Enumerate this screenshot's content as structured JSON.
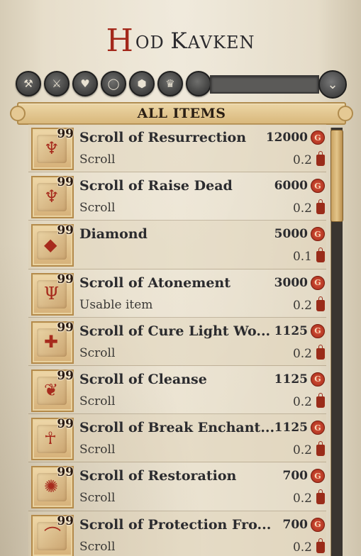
{
  "header": {
    "title_first": "H",
    "title_rest": "OD ",
    "title_second": "K",
    "title_second_rest": "AVKEN"
  },
  "filters": [
    {
      "icon": "crossed-tools-icon",
      "glyph": "⚒"
    },
    {
      "icon": "crossed-swords-icon",
      "glyph": "⚔"
    },
    {
      "icon": "armor-icon",
      "glyph": "♥"
    },
    {
      "icon": "ring-icon",
      "glyph": "◯"
    },
    {
      "icon": "cube-icon",
      "glyph": "⬢"
    },
    {
      "icon": "trophy-icon",
      "glyph": "♛"
    },
    {
      "icon": "blank-icon",
      "glyph": ""
    }
  ],
  "sort_button_glyph": "⌄",
  "category": "ALL ITEMS",
  "items": [
    {
      "qty": "99",
      "name": "Scroll of Resurrection",
      "type": "Scroll",
      "price": "12000",
      "weight": "0.2",
      "fig": "♆"
    },
    {
      "qty": "99",
      "name": "Scroll of Raise Dead",
      "type": "Scroll",
      "price": "6000",
      "weight": "0.2",
      "fig": "♆"
    },
    {
      "qty": "99",
      "name": "Diamond",
      "type": "",
      "price": "5000",
      "weight": "0.1",
      "fig": "◆"
    },
    {
      "qty": "99",
      "name": "Scroll of Atonement",
      "type": "Usable item",
      "price": "3000",
      "weight": "0.2",
      "fig": "Ψ"
    },
    {
      "qty": "99",
      "name": "Scroll of Cure Light Wo...",
      "type": "Scroll",
      "price": "1125",
      "weight": "0.2",
      "fig": "✚"
    },
    {
      "qty": "99",
      "name": "Scroll of Cleanse",
      "type": "Scroll",
      "price": "1125",
      "weight": "0.2",
      "fig": "❦"
    },
    {
      "qty": "99",
      "name": "Scroll of Break Enchant...",
      "type": "Scroll",
      "price": "1125",
      "weight": "0.2",
      "fig": "☥"
    },
    {
      "qty": "99",
      "name": "Scroll of Restoration",
      "type": "Scroll",
      "price": "700",
      "weight": "0.2",
      "fig": "✺"
    },
    {
      "qty": "99",
      "name": "Scroll of Protection Fro...",
      "type": "Scroll",
      "price": "700",
      "weight": "0.2",
      "fig": "⌒"
    }
  ],
  "currency_glyph": "G",
  "colors": {
    "accent_red": "#a3281a",
    "parchment": "#ebe3d1",
    "gold": "#d9b87c"
  }
}
